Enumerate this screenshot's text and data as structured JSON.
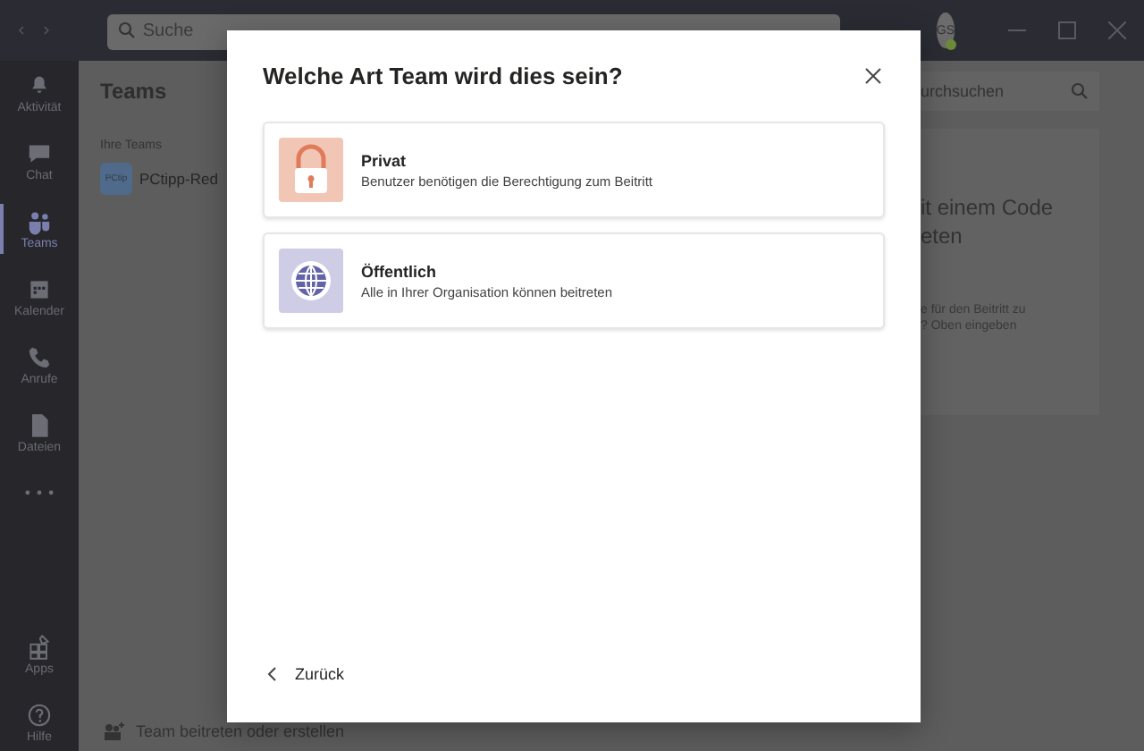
{
  "title_bar": {
    "search_placeholder": "Suche",
    "avatar_initials": "GS"
  },
  "rail": [
    {
      "kind": "bell",
      "label": "Aktivität",
      "selected": false
    },
    {
      "kind": "chat",
      "label": "Chat",
      "selected": false
    },
    {
      "kind": "teams",
      "label": "Teams",
      "selected": true
    },
    {
      "kind": "calendar",
      "label": "Kalender",
      "selected": false
    },
    {
      "kind": "phone",
      "label": "Anrufe",
      "selected": false
    },
    {
      "kind": "file",
      "label": "Dateien",
      "selected": false
    },
    {
      "kind": "more",
      "selected": false
    },
    {
      "kind": "apps",
      "label": "Apps",
      "selected": false
    },
    {
      "kind": "help",
      "label": "Hilfe",
      "selected": false
    }
  ],
  "teams_panel": {
    "title": "Teams",
    "section": "Ihre Teams",
    "teams": [
      {
        "initials": "PCtip",
        "name": "PCtipp-Red"
      }
    ],
    "join_label": "Team beitreten oder erstellen"
  },
  "right_panel": {
    "search_placeholder": "urchsuchen",
    "heading_lines": [
      "it einem Code",
      "eten"
    ],
    "hint_lines": [
      "e für den Beitritt zu",
      "? Oben eingeben"
    ]
  },
  "dialog": {
    "title": "Welche Art Team wird dies sein?",
    "options": [
      {
        "kind": "private",
        "title": "Privat",
        "description": "Benutzer benötigen die Berechtigung zum Beitritt"
      },
      {
        "kind": "public",
        "title": "Öffentlich",
        "description": "Alle in Ihrer Organisation können beitreten"
      }
    ],
    "back_label": "Zurück"
  }
}
